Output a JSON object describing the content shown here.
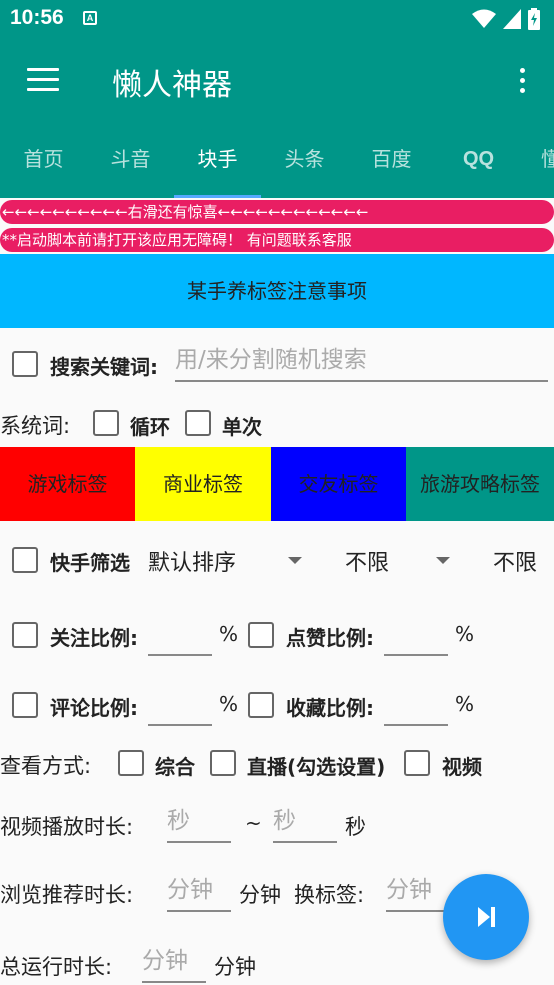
{
  "status": {
    "time": "10:56",
    "badge": "A"
  },
  "appbar": {
    "title": "懒人神器"
  },
  "tabs": [
    "首页",
    "斗音",
    "块手",
    "头条",
    "百度",
    "QQ",
    "懂"
  ],
  "banners": {
    "scroll_hint": "←←←←←←←←←←右滑还有惊喜←←←←←←←←←←←←",
    "accessibility": "**启动脚本前请打开该应用无障碍！ 有问题联系客服"
  },
  "notice_button": "某手养标签注意事项",
  "search": {
    "label": "搜索关键词:",
    "placeholder": "用/来分割随机搜索"
  },
  "system_words": {
    "label": "系统词:",
    "loop": "循环",
    "once": "单次"
  },
  "tags": [
    {
      "label": "游戏标签",
      "bg": "#ff0000",
      "fg": "#222222"
    },
    {
      "label": "商业标签",
      "bg": "#ffff00",
      "fg": "#222222"
    },
    {
      "label": "交友标签",
      "bg": "#0000ff",
      "fg": "#222222"
    },
    {
      "label": "旅游攻略标签",
      "bg": "#009688",
      "fg": "#222222"
    }
  ],
  "filter": {
    "label": "快手筛选",
    "sort": "默认排序",
    "option1": "不限",
    "option2": "不限"
  },
  "ratios": {
    "follow": "关注比例:",
    "like": "点赞比例:",
    "comment": "评论比例:",
    "favorite": "收藏比例:",
    "percent": "%"
  },
  "view_mode": {
    "label": "查看方式:",
    "comprehensive": "综合",
    "live": "直播(勾选设置)",
    "video": "视频"
  },
  "video_duration": {
    "label": "视频播放时长:",
    "min_placeholder": "秒",
    "tilde": "~",
    "max_placeholder": "秒",
    "unit": "秒"
  },
  "browse": {
    "label": "浏览推荐时长:",
    "placeholder": "分钟",
    "unit": "分钟",
    "switch_label": "换标签:",
    "switch_placeholder": "分钟"
  },
  "total": {
    "label": "总运行时长:",
    "placeholder": "分钟",
    "unit": "分钟"
  },
  "colors": {
    "primary": "#009688",
    "banner": "#e91e63",
    "notice": "#00b7ff",
    "fab": "#2196f3"
  }
}
